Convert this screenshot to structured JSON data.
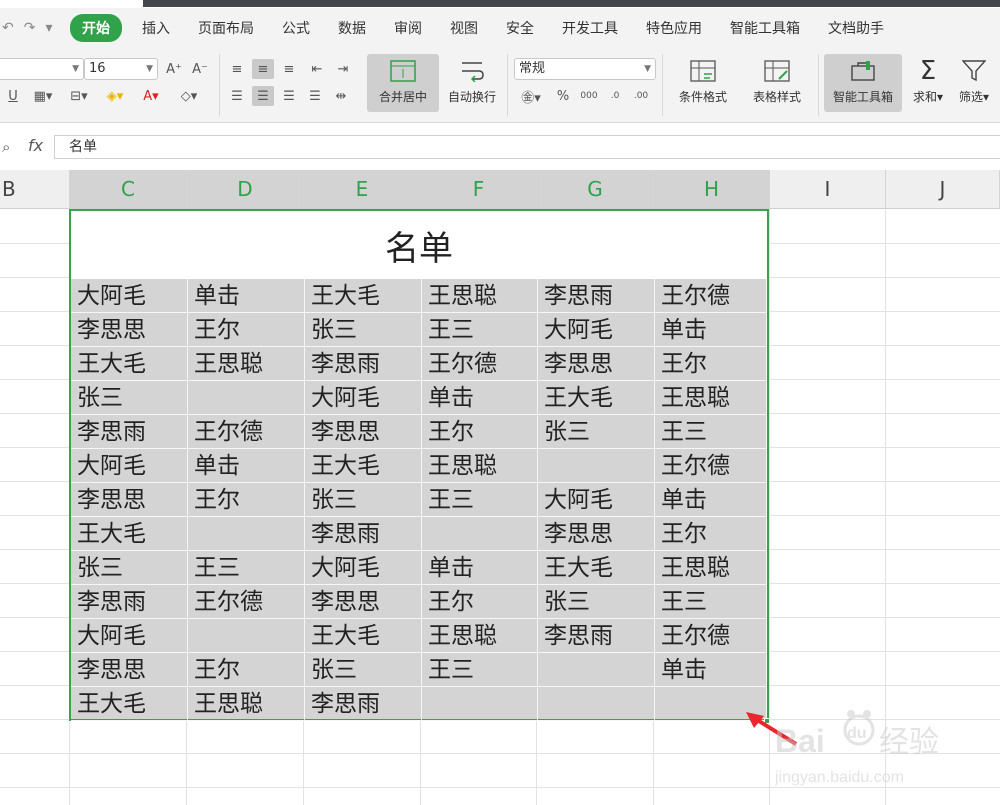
{
  "menubar": {
    "items": [
      "开始",
      "插入",
      "页面布局",
      "公式",
      "数据",
      "审阅",
      "视图",
      "安全",
      "开发工具",
      "特色应用",
      "智能工具箱",
      "文档助手"
    ]
  },
  "ribbon": {
    "font_size": "16",
    "number_format": "常规",
    "merge_label": "合并居中",
    "wrap_label": "自动换行",
    "cond_label": "条件格式",
    "table_style_label": "表格样式",
    "smart_toolbox_label": "智能工具箱",
    "sum_label": "求和",
    "filter_label": "筛选"
  },
  "formula_bar": {
    "value": "名单"
  },
  "columns": [
    "B",
    "C",
    "D",
    "E",
    "F",
    "G",
    "H",
    "I",
    "J"
  ],
  "table": {
    "title": "名单",
    "rows": [
      [
        "大阿毛",
        "单击",
        "王大毛",
        "王思聪",
        "李思雨",
        "王尔德"
      ],
      [
        "李思思",
        "王尔",
        "张三",
        "王三",
        "大阿毛",
        "单击"
      ],
      [
        "王大毛",
        "王思聪",
        "李思雨",
        "王尔德",
        "李思思",
        "王尔"
      ],
      [
        "张三",
        "",
        "大阿毛",
        "单击",
        "王大毛",
        "王思聪"
      ],
      [
        "李思雨",
        "王尔德",
        "李思思",
        "王尔",
        "张三",
        "王三"
      ],
      [
        "大阿毛",
        "单击",
        "王大毛",
        "王思聪",
        "",
        "王尔德"
      ],
      [
        "李思思",
        "王尔",
        "张三",
        "王三",
        "大阿毛",
        "单击"
      ],
      [
        "王大毛",
        "",
        "李思雨",
        "",
        "李思思",
        "王尔"
      ],
      [
        "张三",
        "王三",
        "大阿毛",
        "单击",
        "王大毛",
        "王思聪"
      ],
      [
        "李思雨",
        "王尔德",
        "李思思",
        "王尔",
        "张三",
        "王三"
      ],
      [
        "大阿毛",
        "",
        "王大毛",
        "王思聪",
        "李思雨",
        "王尔德"
      ],
      [
        "李思思",
        "王尔",
        "张三",
        "王三",
        "",
        "单击"
      ],
      [
        "王大毛",
        "王思聪",
        "李思雨",
        "",
        "",
        ""
      ]
    ]
  },
  "watermark": {
    "brand": "Bai",
    "suffix": "经验",
    "url": "jingyan.baidu.com"
  },
  "colors": {
    "accent": "#2fa24a",
    "selection": "#d4d4d4",
    "arrow": "#e8262c"
  }
}
